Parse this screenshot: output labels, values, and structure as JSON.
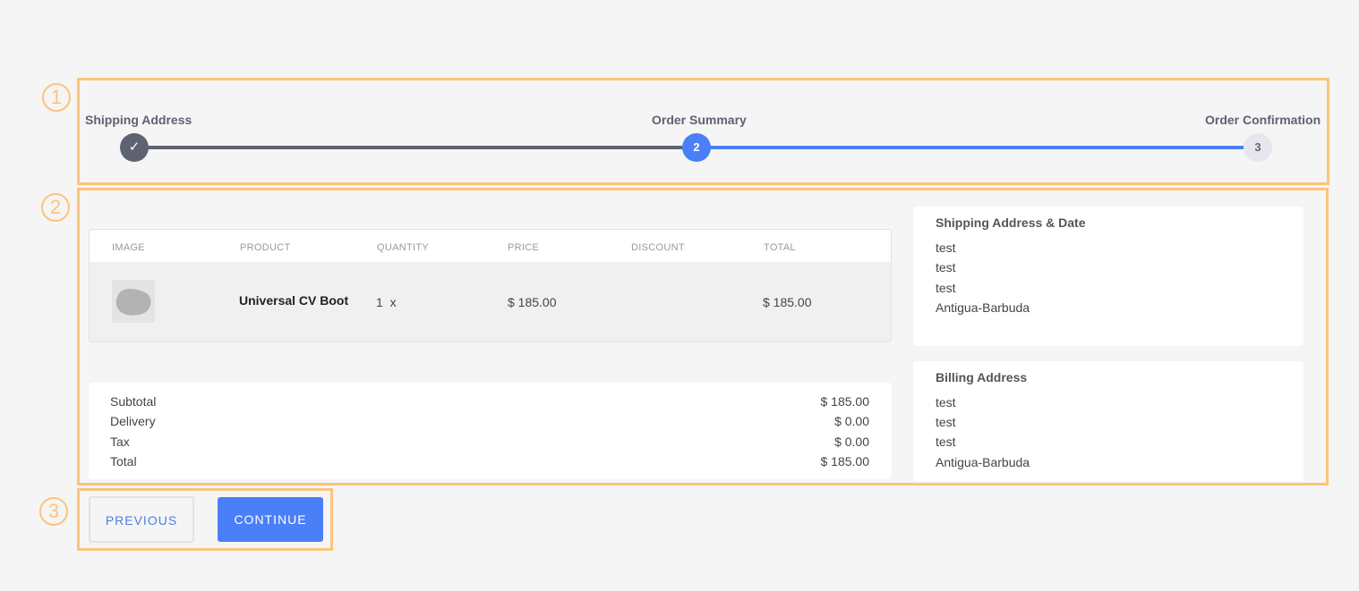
{
  "annotations": [
    "1",
    "2",
    "3"
  ],
  "stepper": {
    "steps": [
      {
        "label": "Shipping Address",
        "state": "completed",
        "marker": "✓"
      },
      {
        "label": "Order Summary",
        "state": "active",
        "marker": "2"
      },
      {
        "label": "Order Confirmation",
        "state": "pending",
        "marker": "3"
      }
    ],
    "colors": {
      "completed": "#5f6270",
      "active": "#4a7ff7",
      "pending": "#e6e7ee"
    }
  },
  "table": {
    "headers": [
      "IMAGE",
      "PRODUCT",
      "QUANTITY",
      "PRICE",
      "DISCOUNT",
      "TOTAL"
    ],
    "rows": [
      {
        "product": "Universal CV Boot",
        "quantity": "1",
        "qty_suffix": "x",
        "price": "$ 185.00",
        "discount": "",
        "total": "$ 185.00"
      }
    ]
  },
  "totals": [
    {
      "label": "Subtotal",
      "value": "$ 185.00"
    },
    {
      "label": "Delivery",
      "value": "$ 0.00"
    },
    {
      "label": "Tax",
      "value": "$ 0.00"
    },
    {
      "label": "Total",
      "value": "$ 185.00"
    }
  ],
  "shipping": {
    "title": "Shipping Address & Date",
    "lines": [
      "test",
      "test",
      "test",
      "Antigua-Barbuda"
    ]
  },
  "billing": {
    "title": "Billing Address",
    "lines": [
      "test",
      "test",
      "test",
      "Antigua-Barbuda"
    ]
  },
  "buttons": {
    "previous": "PREVIOUS",
    "continue": "CONTINUE"
  }
}
